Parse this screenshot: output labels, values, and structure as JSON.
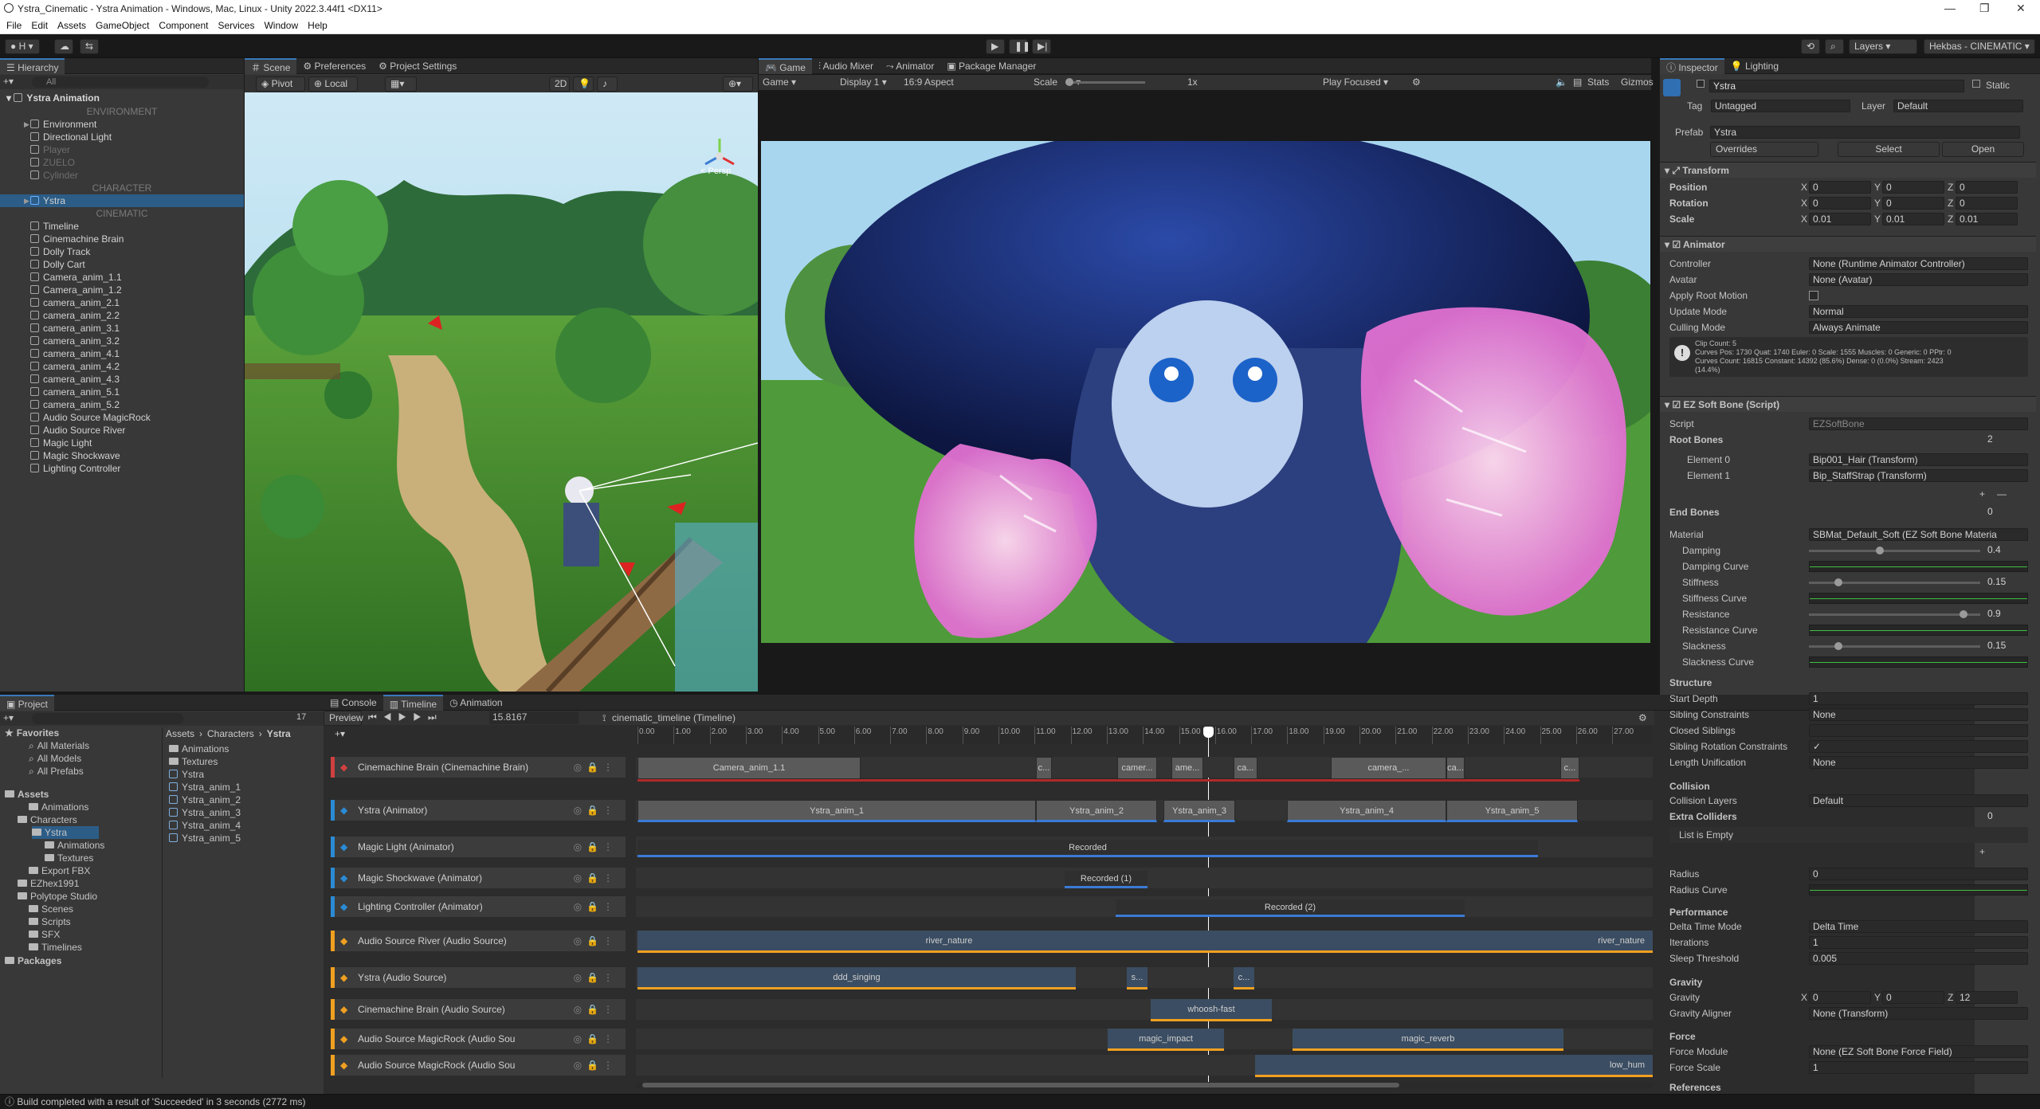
{
  "window": {
    "title": "Ystra_Cinematic - Ystra Animation - Windows, Mac, Linux - Unity 2022.3.44f1 <DX11>"
  },
  "menu": [
    "File",
    "Edit",
    "Assets",
    "GameObject",
    "Component",
    "Services",
    "Window",
    "Help"
  ],
  "toolbar": {
    "account": "H",
    "layers": "Layers",
    "layout": "Hekbas - CINEMATIC"
  },
  "hierarchy": {
    "tab": "Hierarchy",
    "search": "All",
    "scene": "Ystra Animation",
    "items": [
      {
        "label": "ENVIRONMENT",
        "type": "sep"
      },
      {
        "label": "Environment",
        "type": "obj",
        "fold": true
      },
      {
        "label": "Directional Light",
        "type": "obj"
      },
      {
        "label": "Player",
        "type": "dim"
      },
      {
        "label": "ZUELO",
        "type": "dim"
      },
      {
        "label": "Cylinder",
        "type": "dim"
      },
      {
        "label": "CHARACTER",
        "type": "sep"
      },
      {
        "label": "Ystra",
        "type": "sel",
        "fold": true
      },
      {
        "label": "CINEMATIC",
        "type": "sep"
      },
      {
        "label": "Timeline",
        "type": "obj"
      },
      {
        "label": "Cinemachine Brain",
        "type": "obj"
      },
      {
        "label": "Dolly Track",
        "type": "obj"
      },
      {
        "label": "Dolly Cart",
        "type": "obj"
      },
      {
        "label": "Camera_anim_1.1",
        "type": "obj"
      },
      {
        "label": "Camera_anim_1.2",
        "type": "obj"
      },
      {
        "label": "camera_anim_2.1",
        "type": "obj"
      },
      {
        "label": "camera_anim_2.2",
        "type": "obj"
      },
      {
        "label": "camera_anim_3.1",
        "type": "obj"
      },
      {
        "label": "camera_anim_3.2",
        "type": "obj"
      },
      {
        "label": "camera_anim_4.1",
        "type": "obj"
      },
      {
        "label": "camera_anim_4.2",
        "type": "obj"
      },
      {
        "label": "camera_anim_4.3",
        "type": "obj"
      },
      {
        "label": "camera_anim_5.1",
        "type": "obj"
      },
      {
        "label": "camera_anim_5.2",
        "type": "obj"
      },
      {
        "label": "Audio Source MagicRock",
        "type": "obj"
      },
      {
        "label": "Audio Source River",
        "type": "obj"
      },
      {
        "label": "Magic Light",
        "type": "obj"
      },
      {
        "label": "Magic Shockwave",
        "type": "obj"
      },
      {
        "label": "Lighting Controller",
        "type": "obj"
      }
    ]
  },
  "scene": {
    "tabs": [
      "Scene",
      "Preferences",
      "Project Settings"
    ],
    "pivot": "Pivot",
    "local": "Local",
    "mode2d": "2D",
    "persp": "< Persp"
  },
  "game": {
    "tabs": [
      "Game",
      "Audio Mixer",
      "Animator",
      "Package Manager"
    ],
    "display_mode": "Game",
    "display": "Display 1",
    "aspect": "16:9 Aspect",
    "scale_label": "Scale",
    "scale_value": "1x",
    "play_mode": "Play Focused",
    "stats": "Stats",
    "gizmos": "Gizmos"
  },
  "inspector": {
    "tabs": [
      "Inspector",
      "Lighting"
    ],
    "name": "Ystra",
    "static": "Static",
    "tag_label": "Tag",
    "tag": "Untagged",
    "layer_label": "Layer",
    "layer": "Default",
    "prefab_label": "Prefab",
    "prefab": "Ystra",
    "overrides": "Overrides",
    "select": "Select",
    "open": "Open",
    "transform": {
      "title": "Transform",
      "rows": [
        {
          "label": "Position",
          "x": "0",
          "y": "0",
          "z": "0"
        },
        {
          "label": "Rotation",
          "x": "0",
          "y": "0",
          "z": "0"
        },
        {
          "label": "Scale",
          "x": "0.01",
          "y": "0.01",
          "z": "0.01"
        }
      ]
    },
    "animator": {
      "title": "Animator",
      "rows": [
        {
          "label": "Controller",
          "value": "None (Runtime Animator Controller)"
        },
        {
          "label": "Avatar",
          "value": "None (Avatar)"
        },
        {
          "label": "Apply Root Motion",
          "value": ""
        },
        {
          "label": "Update Mode",
          "value": "Normal"
        },
        {
          "label": "Culling Mode",
          "value": "Always Animate"
        }
      ],
      "info": [
        "Clip Count: 5",
        "Curves Pos: 1730 Quat: 1740 Euler: 0 Scale: 1555 Muscles: 0 Generic: 0 PPtr: 0",
        "Curves Count: 16815 Constant: 14392 (85.6%) Dense: 0 (0.0%) Stream: 2423",
        "(14.4%)"
      ]
    },
    "softbone": {
      "title": "EZ Soft Bone (Script)",
      "script_label": "Script",
      "script": "EZSoftBone",
      "root_bones": "Root Bones",
      "root_count": "2",
      "elements": [
        {
          "label": "Element 0",
          "value": "Bip001_Hair (Transform)"
        },
        {
          "label": "Element 1",
          "value": "Bip_StaffStrap (Transform)"
        }
      ],
      "end_bones": "End Bones",
      "end_count": "0",
      "material_label": "Material",
      "material": "SBMat_Default_Soft (EZ Soft Bone Materia",
      "params": [
        {
          "label": "Damping",
          "value": "0.4",
          "fraction": 0.4
        },
        {
          "label": "Damping Curve",
          "curve": true
        },
        {
          "label": "Stiffness",
          "value": "0.15",
          "fraction": 0.15
        },
        {
          "label": "Stiffness Curve",
          "curve": true
        },
        {
          "label": "Resistance",
          "value": "0.9",
          "fraction": 0.9
        },
        {
          "label": "Resistance Curve",
          "curve": true
        },
        {
          "label": "Slackness",
          "value": "0.15",
          "fraction": 0.15
        },
        {
          "label": "Slackness Curve",
          "curve": true
        }
      ],
      "structure": "Structure",
      "structure_rows": [
        {
          "label": "Start Depth",
          "value": "1"
        },
        {
          "label": "Sibling Constraints",
          "value": "None"
        },
        {
          "label": "Closed Siblings",
          "value": ""
        },
        {
          "label": "Sibling Rotation Constraints",
          "value": "✓"
        },
        {
          "label": "Length Unification",
          "value": "None"
        }
      ],
      "collision": "Collision",
      "collision_layers_label": "Collision Layers",
      "collision_layers": "Default",
      "extra_colliders": "Extra Colliders",
      "extra_count": "0",
      "list_empty": "List is Empty",
      "radius_label": "Radius",
      "radius": "0",
      "radius_curve": "Radius Curve",
      "performance": "Performance",
      "perf_rows": [
        {
          "label": "Delta Time Mode",
          "value": "Delta Time"
        },
        {
          "label": "Iterations",
          "value": "1"
        },
        {
          "label": "Sleep Threshold",
          "value": "0.005"
        }
      ],
      "gravity": "Gravity",
      "gravity_label": "Gravity",
      "gx": "0",
      "gy": "0",
      "gz": "12",
      "gravity_aligner_label": "Gravity Aligner",
      "gravity_aligner": "None (Transform)",
      "force": "Force",
      "force_module_label": "Force Module",
      "force_module": "None (EZ Soft Bone Force Field)",
      "force_scale_label": "Force Scale",
      "force_scale": "1",
      "references": "References"
    }
  },
  "project": {
    "tab": "Project",
    "count": "17",
    "favorites": [
      "Favorites",
      "All Materials",
      "All Models",
      "All Prefabs"
    ],
    "tree": [
      "Assets",
      "Animations",
      "Characters",
      "Ystra",
      "Animations",
      "Textures",
      "Export FBX",
      "EZhex1991",
      "Polytope Studio",
      "Scenes",
      "Scripts",
      "SFX",
      "Timelines",
      "Packages"
    ],
    "breadcrumb": [
      "Assets",
      "Characters",
      "Ystra"
    ],
    "files": [
      "Animations",
      "Textures",
      "Ystra",
      "Ystra_anim_1",
      "Ystra_anim_2",
      "Ystra_anim_3",
      "Ystra_anim_4",
      "Ystra_anim_5"
    ]
  },
  "timeline": {
    "tabs": [
      "Console",
      "Timeline",
      "Animation"
    ],
    "preview": "Preview",
    "frame": "15.8167",
    "asset": "cinematic_timeline (Timeline)",
    "ruler": [
      "0.00",
      "1.00",
      "2.00",
      "3.00",
      "4.00",
      "5.00",
      "6.00",
      "7.00",
      "8.00",
      "9.00",
      "10.00",
      "11.00",
      "12.00",
      "13.00",
      "14.00",
      "15.00",
      "16.00",
      "17.00",
      "18.00",
      "19.00",
      "20.00",
      "21.00",
      "22.00",
      "23.00",
      "24.00",
      "25.00",
      "26.00",
      "27.00"
    ],
    "tracks": [
      {
        "label": "Cinemachine Brain (Cinemachine Brain)",
        "color": "#d04040"
      },
      {
        "label": "Ystra (Animator)",
        "color": "#2a8ad4"
      },
      {
        "label": "Magic Light (Animator)",
        "color": "#2a8ad4"
      },
      {
        "label": "Magic Shockwave (Animator)",
        "color": "#2a8ad4"
      },
      {
        "label": "Lighting Controller (Animator)",
        "color": "#2a8ad4"
      },
      {
        "label": "Audio Source River (Audio Source)",
        "color": "#f0a020"
      },
      {
        "label": "Ystra (Audio Source)",
        "color": "#f0a020"
      },
      {
        "label": "Cinemachine Brain (Audio Source)",
        "color": "#f0a020"
      },
      {
        "label": "Audio Source MagicRock (Audio Sou",
        "color": "#f0a020"
      },
      {
        "label": "Audio Source MagicRock (Audio Sou",
        "color": "#f0a020"
      }
    ],
    "clips": {
      "cam": [
        "Camera_anim_1.1",
        "c...",
        "camer...",
        "ame...",
        "ca...",
        "camera_...",
        "ca...",
        "c..."
      ],
      "ystra": [
        "Ystra_anim_1",
        "Ystra_anim_2",
        "Ystra_anim_3",
        "Ystra_anim_4",
        "Ystra_anim_5"
      ],
      "magic_light": "Recorded",
      "shockwave": "Recorded (1)",
      "lighting": "Recorded (2)",
      "river": [
        "river_nature",
        "river_nature"
      ],
      "singing": [
        "ddd_singing",
        "s...",
        "c..."
      ],
      "whoosh": "whoosh-fast",
      "magic": [
        "magic_impact",
        "magic_reverb"
      ],
      "low": "low_hum"
    },
    "playhead_time": 15.8167
  },
  "status": "Build completed with a result of 'Succeeded' in 3 seconds (2772 ms)"
}
